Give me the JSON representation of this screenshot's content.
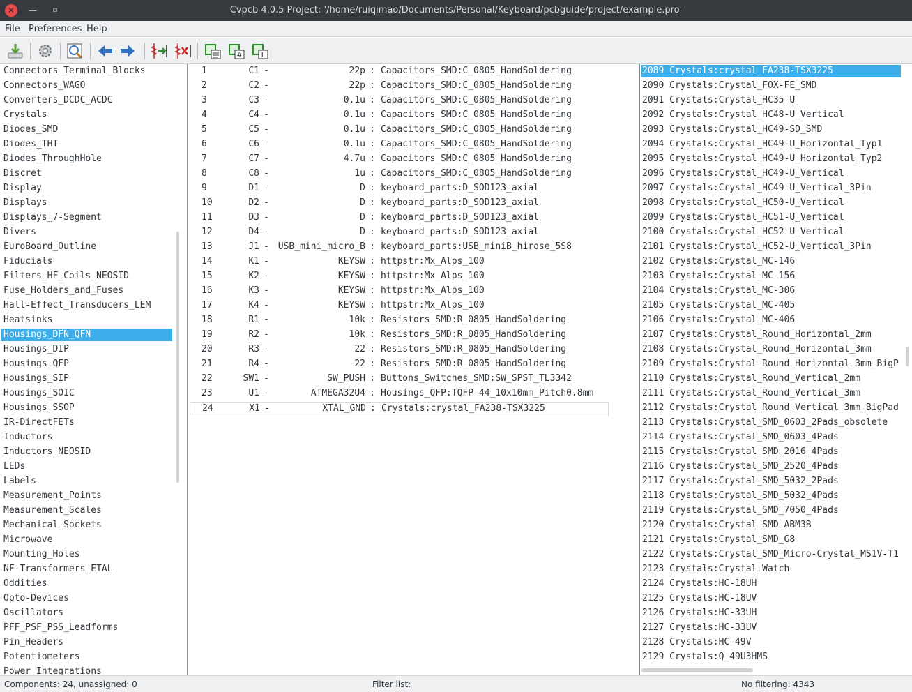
{
  "window": {
    "title": "Cvpcb 4.0.5  Project: '/home/ruiqimao/Documents/Personal/Keyboard/pcbguide/project/example.pro'"
  },
  "menu": [
    "File",
    "Preferences",
    "Help"
  ],
  "toolbar": [
    {
      "name": "save-icon",
      "color": "#5a9e3a"
    },
    {
      "name": "settings-gear-icon",
      "color": "#8a8d90"
    },
    {
      "name": "footprint-viewer-icon",
      "color": "#3a78c9"
    },
    {
      "name": "previous-arrow-icon",
      "color": "#2f6fc4"
    },
    {
      "name": "next-arrow-icon",
      "color": "#2f6fc4"
    },
    {
      "name": "auto-associate-icon",
      "color": "#c03030"
    },
    {
      "name": "delete-associations-icon",
      "color": "#c03030"
    },
    {
      "name": "filter-by-keywords-icon",
      "color": "#2e8b2e"
    },
    {
      "name": "filter-by-pin-count-icon",
      "color": "#2e8b2e"
    },
    {
      "name": "filter-by-library-icon",
      "color": "#2e8b2e"
    }
  ],
  "libraries": {
    "selected_index": 18,
    "items": [
      "Connectors_Terminal_Blocks",
      "Connectors_WAGO",
      "Converters_DCDC_ACDC",
      "Crystals",
      "Diodes_SMD",
      "Diodes_THT",
      "Diodes_ThroughHole",
      "Discret",
      "Display",
      "Displays",
      "Displays_7-Segment",
      "Divers",
      "EuroBoard_Outline",
      "Fiducials",
      "Filters_HF_Coils_NEOSID",
      "Fuse_Holders_and_Fuses",
      "Hall-Effect_Transducers_LEM",
      "Heatsinks",
      "Housings_DFN_QFN",
      "Housings_DIP",
      "Housings_QFP",
      "Housings_SIP",
      "Housings_SOIC",
      "Housings_SSOP",
      "IR-DirectFETs",
      "Inductors",
      "Inductors_NEOSID",
      "LEDs",
      "Labels",
      "Measurement_Points",
      "Measurement_Scales",
      "Mechanical_Sockets",
      "Microwave",
      "Mounting_Holes",
      "NF-Transformers_ETAL",
      "Oddities",
      "Opto-Devices",
      "Oscillators",
      "PFF_PSF_PSS_Leadforms",
      "Pin_Headers",
      "Potentiometers",
      "Power_Integrations"
    ]
  },
  "components": {
    "current_index": 23,
    "rows": [
      {
        "idx": "1",
        "ref": "C1",
        "value": "22p",
        "footprint": "Capacitors_SMD:C_0805_HandSoldering"
      },
      {
        "idx": "2",
        "ref": "C2",
        "value": "22p",
        "footprint": "Capacitors_SMD:C_0805_HandSoldering"
      },
      {
        "idx": "3",
        "ref": "C3",
        "value": "0.1u",
        "footprint": "Capacitors_SMD:C_0805_HandSoldering"
      },
      {
        "idx": "4",
        "ref": "C4",
        "value": "0.1u",
        "footprint": "Capacitors_SMD:C_0805_HandSoldering"
      },
      {
        "idx": "5",
        "ref": "C5",
        "value": "0.1u",
        "footprint": "Capacitors_SMD:C_0805_HandSoldering"
      },
      {
        "idx": "6",
        "ref": "C6",
        "value": "0.1u",
        "footprint": "Capacitors_SMD:C_0805_HandSoldering"
      },
      {
        "idx": "7",
        "ref": "C7",
        "value": "4.7u",
        "footprint": "Capacitors_SMD:C_0805_HandSoldering"
      },
      {
        "idx": "8",
        "ref": "C8",
        "value": "1u",
        "footprint": "Capacitors_SMD:C_0805_HandSoldering"
      },
      {
        "idx": "9",
        "ref": "D1",
        "value": "D",
        "footprint": "keyboard_parts:D_SOD123_axial"
      },
      {
        "idx": "10",
        "ref": "D2",
        "value": "D",
        "footprint": "keyboard_parts:D_SOD123_axial"
      },
      {
        "idx": "11",
        "ref": "D3",
        "value": "D",
        "footprint": "keyboard_parts:D_SOD123_axial"
      },
      {
        "idx": "12",
        "ref": "D4",
        "value": "D",
        "footprint": "keyboard_parts:D_SOD123_axial"
      },
      {
        "idx": "13",
        "ref": "J1",
        "value": "USB_mini_micro_B",
        "footprint": "keyboard_parts:USB_miniB_hirose_5S8"
      },
      {
        "idx": "14",
        "ref": "K1",
        "value": "KEYSW",
        "footprint": "httpstr:Mx_Alps_100"
      },
      {
        "idx": "15",
        "ref": "K2",
        "value": "KEYSW",
        "footprint": "httpstr:Mx_Alps_100"
      },
      {
        "idx": "16",
        "ref": "K3",
        "value": "KEYSW",
        "footprint": "httpstr:Mx_Alps_100"
      },
      {
        "idx": "17",
        "ref": "K4",
        "value": "KEYSW",
        "footprint": "httpstr:Mx_Alps_100"
      },
      {
        "idx": "18",
        "ref": "R1",
        "value": "10k",
        "footprint": "Resistors_SMD:R_0805_HandSoldering"
      },
      {
        "idx": "19",
        "ref": "R2",
        "value": "10k",
        "footprint": "Resistors_SMD:R_0805_HandSoldering"
      },
      {
        "idx": "20",
        "ref": "R3",
        "value": "22",
        "footprint": "Resistors_SMD:R_0805_HandSoldering"
      },
      {
        "idx": "21",
        "ref": "R4",
        "value": "22",
        "footprint": "Resistors_SMD:R_0805_HandSoldering"
      },
      {
        "idx": "22",
        "ref": "SW1",
        "value": "SW_PUSH",
        "footprint": "Buttons_Switches_SMD:SW_SPST_TL3342"
      },
      {
        "idx": "23",
        "ref": "U1",
        "value": "ATMEGA32U4",
        "footprint": "Housings_QFP:TQFP-44_10x10mm_Pitch0.8mm"
      },
      {
        "idx": "24",
        "ref": "X1",
        "value": "XTAL_GND",
        "footprint": "Crystals:crystal_FA238-TSX3225"
      }
    ]
  },
  "footprints": {
    "selected_index": 0,
    "items": [
      "2089 Crystals:crystal_FA238-TSX3225",
      "2090 Crystals:Crystal_FOX-FE_SMD",
      "2091 Crystals:Crystal_HC35-U",
      "2092 Crystals:Crystal_HC48-U_Vertical",
      "2093 Crystals:Crystal_HC49-SD_SMD",
      "2094 Crystals:Crystal_HC49-U_Horizontal_Typ1",
      "2095 Crystals:Crystal_HC49-U_Horizontal_Typ2",
      "2096 Crystals:Crystal_HC49-U_Vertical",
      "2097 Crystals:Crystal_HC49-U_Vertical_3Pin",
      "2098 Crystals:Crystal_HC50-U_Vertical",
      "2099 Crystals:Crystal_HC51-U_Vertical",
      "2100 Crystals:Crystal_HC52-U_Vertical",
      "2101 Crystals:Crystal_HC52-U_Vertical_3Pin",
      "2102 Crystals:Crystal_MC-146",
      "2103 Crystals:Crystal_MC-156",
      "2104 Crystals:Crystal_MC-306",
      "2105 Crystals:Crystal_MC-405",
      "2106 Crystals:Crystal_MC-406",
      "2107 Crystals:Crystal_Round_Horizontal_2mm",
      "2108 Crystals:Crystal_Round_Horizontal_3mm",
      "2109 Crystals:Crystal_Round_Horizontal_3mm_BigP",
      "2110 Crystals:Crystal_Round_Vertical_2mm",
      "2111 Crystals:Crystal_Round_Vertical_3mm",
      "2112 Crystals:Crystal_Round_Vertical_3mm_BigPad",
      "2113 Crystals:Crystal_SMD_0603_2Pads_obsolete",
      "2114 Crystals:Crystal_SMD_0603_4Pads",
      "2115 Crystals:Crystal_SMD_2016_4Pads",
      "2116 Crystals:Crystal_SMD_2520_4Pads",
      "2117 Crystals:Crystal_SMD_5032_2Pads",
      "2118 Crystals:Crystal_SMD_5032_4Pads",
      "2119 Crystals:Crystal_SMD_7050_4Pads",
      "2120 Crystals:Crystal_SMD_ABM3B",
      "2121 Crystals:Crystal_SMD_G8",
      "2122 Crystals:Crystal_SMD_Micro-Crystal_MS1V-T1",
      "2123 Crystals:Crystal_Watch",
      "2124 Crystals:HC-18UH",
      "2125 Crystals:HC-18UV",
      "2126 Crystals:HC-33UH",
      "2127 Crystals:HC-33UV",
      "2128 Crystals:HC-49V",
      "2129 Crystals:Q_49U3HMS"
    ]
  },
  "status": {
    "components": "Components: 24, unassigned: 0",
    "filter": "Filter list:",
    "filtering": "No filtering: 4343"
  },
  "colors": {
    "selection": "#3daee9",
    "titlebar": "#363a3e",
    "toolbar": "#eff0f1"
  }
}
